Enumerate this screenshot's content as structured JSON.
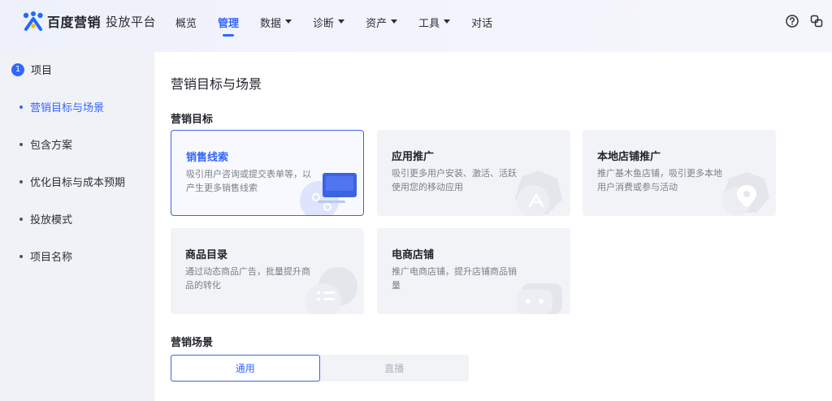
{
  "app": {
    "logo_text": "百度营销",
    "logo_sub": "投放平台"
  },
  "nav": [
    {
      "label": "概览",
      "dropdown": false,
      "active": false
    },
    {
      "label": "管理",
      "dropdown": false,
      "active": true
    },
    {
      "label": "数据",
      "dropdown": true,
      "active": false
    },
    {
      "label": "诊断",
      "dropdown": true,
      "active": false
    },
    {
      "label": "资产",
      "dropdown": true,
      "active": false
    },
    {
      "label": "工具",
      "dropdown": true,
      "active": false
    },
    {
      "label": "对话",
      "dropdown": false,
      "active": false
    }
  ],
  "sidebar": {
    "step_number": "1",
    "step_title": "项目",
    "items": [
      {
        "label": "营销目标与场景",
        "active": true
      },
      {
        "label": "包含方案",
        "active": false
      },
      {
        "label": "优化目标与成本预期",
        "active": false
      },
      {
        "label": "投放模式",
        "active": false
      },
      {
        "label": "项目名称",
        "active": false
      }
    ]
  },
  "main": {
    "title": "营销目标与场景",
    "goal_section": "营销目标",
    "cards": [
      {
        "title": "销售线索",
        "desc": "吸引用户咨询或提交表单等，以产生更多销售线索",
        "selected": true,
        "icon": "form-leads-icon"
      },
      {
        "title": "应用推广",
        "desc": "吸引更多用户安装、激活、活跃使用您的移动应用",
        "selected": false,
        "icon": "app-store-icon"
      },
      {
        "title": "本地店铺推广",
        "desc": "推广基木鱼店铺，吸引更多本地用户消费或参与活动",
        "selected": false,
        "icon": "location-pin-icon"
      },
      {
        "title": "商品目录",
        "desc": "通过动态商品广告，批量提升商品的转化",
        "selected": false,
        "icon": "catalog-list-icon"
      },
      {
        "title": "电商店铺",
        "desc": "推广电商店铺，提升店铺商品销量",
        "selected": false,
        "icon": "shop-bag-icon"
      }
    ],
    "scene_section": "营销场景",
    "scenes": [
      {
        "label": "通用",
        "active": true
      },
      {
        "label": "直播",
        "active": false
      }
    ]
  },
  "colors": {
    "accent": "#3365ff",
    "card_bg": "#f2f3f7",
    "selected_border": "#3d64e0"
  }
}
